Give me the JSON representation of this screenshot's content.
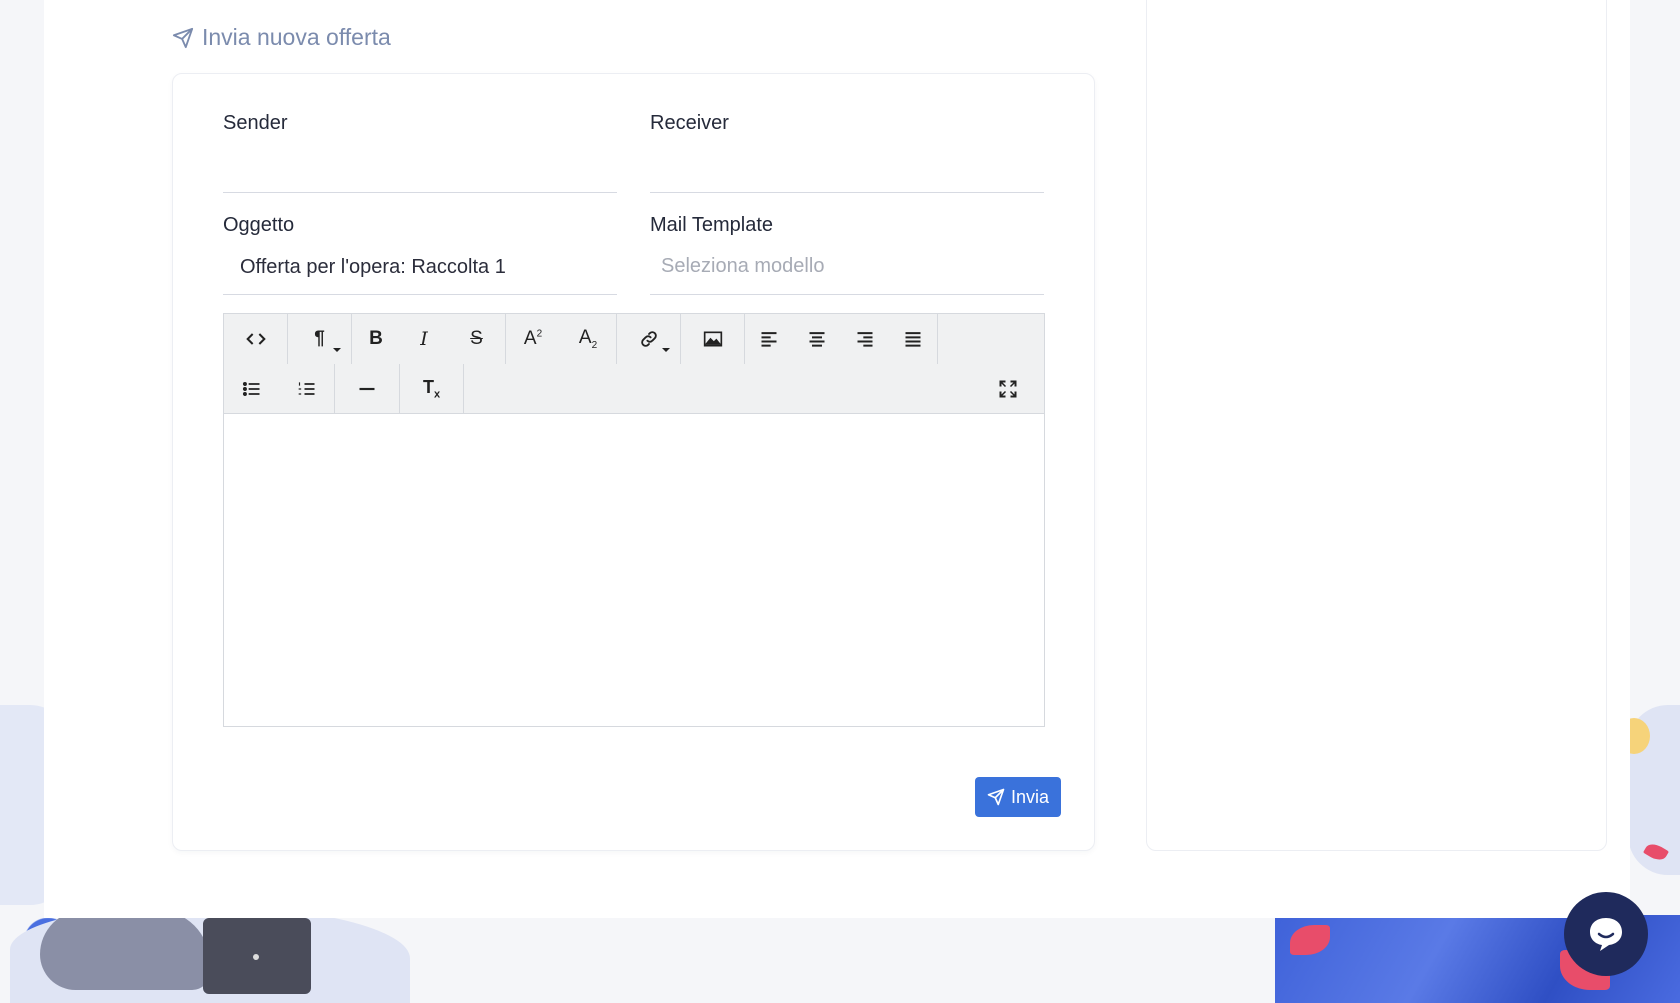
{
  "section": {
    "title": "Invia nuova offerta",
    "icon": "send-icon"
  },
  "form": {
    "sender": {
      "label": "Sender",
      "value": ""
    },
    "receiver": {
      "label": "Receiver",
      "value": ""
    },
    "subject": {
      "label": "Oggetto",
      "value": "Offerta per l'opera: Raccolta 1"
    },
    "mail_template": {
      "label": "Mail Template",
      "placeholder": "Seleziona modello"
    }
  },
  "editor": {
    "toolbar_row1": [
      {
        "name": "code-view-icon",
        "glyph": "<>"
      },
      {
        "name": "paragraph-style-icon",
        "glyph": "¶"
      },
      {
        "name": "bold-icon",
        "glyph": "B"
      },
      {
        "name": "italic-icon",
        "glyph": "I"
      },
      {
        "name": "strikethrough-icon",
        "glyph": "S"
      },
      {
        "name": "superscript-icon",
        "glyph": "A²"
      },
      {
        "name": "subscript-icon",
        "glyph": "A₂"
      },
      {
        "name": "link-icon",
        "glyph": "link"
      },
      {
        "name": "image-icon",
        "glyph": "img"
      },
      {
        "name": "align-left-icon",
        "glyph": "left"
      },
      {
        "name": "align-center-icon",
        "glyph": "center"
      },
      {
        "name": "align-right-icon",
        "glyph": "right"
      },
      {
        "name": "align-justify-icon",
        "glyph": "justify"
      }
    ],
    "toolbar_row2": [
      {
        "name": "unordered-list-icon"
      },
      {
        "name": "ordered-list-icon"
      },
      {
        "name": "horizontal-rule-icon"
      },
      {
        "name": "clear-format-icon",
        "glyph": "Tx"
      },
      {
        "name": "fullscreen-icon"
      }
    ],
    "content": ""
  },
  "actions": {
    "send_label": "Invia"
  },
  "colors": {
    "primary": "#3a72db",
    "chat": "#1f2a5c",
    "title": "#7b8bad"
  }
}
